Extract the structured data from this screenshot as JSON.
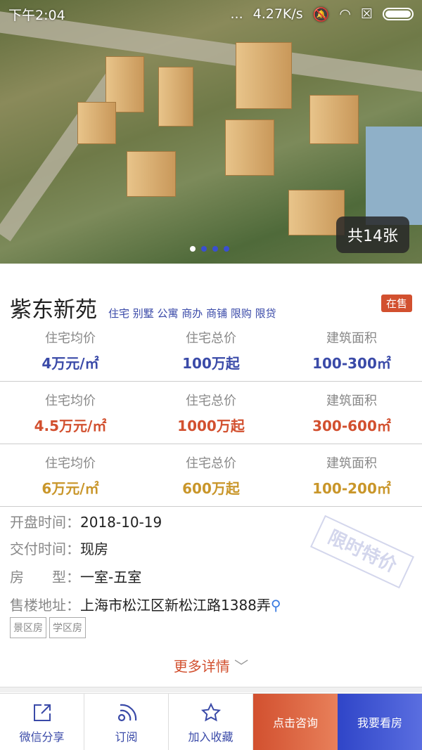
{
  "status_bar": {
    "time": "下午2:04",
    "speed": "4.27K/s",
    "dots": "..."
  },
  "gallery": {
    "count_label": "共14张",
    "page_count": 4,
    "current_page": 1
  },
  "property": {
    "name": "紫东新苑",
    "tags": "住宅 别墅 公寓 商办 商铺 限购 限贷",
    "status": "在售",
    "price_rows": [
      {
        "color": "#3a4aa8",
        "items": [
          {
            "label": "住宅均价",
            "value": "4万元/㎡"
          },
          {
            "label": "住宅总价",
            "value": "100万起"
          },
          {
            "label": "建筑面积",
            "value": "100-300㎡"
          }
        ]
      },
      {
        "color": "#d2502f",
        "items": [
          {
            "label": "住宅均价",
            "value": "4.5万元/㎡"
          },
          {
            "label": "住宅总价",
            "value": "1000万起"
          },
          {
            "label": "建筑面积",
            "value": "300-600㎡"
          }
        ]
      },
      {
        "color": "#c9962a",
        "items": [
          {
            "label": "住宅均价",
            "value": "6万元/㎡"
          },
          {
            "label": "住宅总价",
            "value": "600万起"
          },
          {
            "label": "建筑面积",
            "value": "100-200㎡"
          }
        ]
      }
    ],
    "info": [
      {
        "key": "开盘时间：",
        "value": "2018-10-19"
      },
      {
        "key": "交付时间：",
        "value": "现房"
      },
      {
        "key": "房　　型：",
        "value": "一室-五室"
      },
      {
        "key": "售楼地址：",
        "value": "上海市松江区新松江路1388弄"
      }
    ],
    "chips": [
      "景区房",
      "学区房"
    ],
    "stamp": "限时特价",
    "more": "更多详情"
  },
  "bottom_bar": {
    "share": "微信分享",
    "subscribe": "订阅",
    "favorite": "加入收藏",
    "consult": "点击咨询",
    "visit": "我要看房"
  },
  "colors": {
    "accent_blue": "#3a4aa8",
    "accent_red": "#d2502f",
    "accent_gold": "#c9962a"
  }
}
